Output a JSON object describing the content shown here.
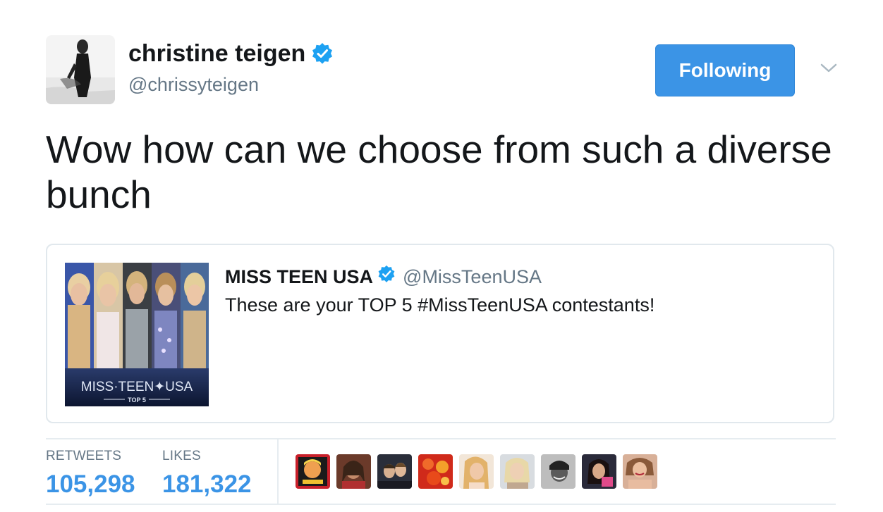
{
  "author": {
    "name": "christine teigen",
    "handle": "@chrissyteigen",
    "verified": true
  },
  "follow_button": {
    "label": "Following"
  },
  "tweet": {
    "text": "Wow how can we choose from such a diverse bunch"
  },
  "quoted_tweet": {
    "name": "MISS TEEN USA",
    "handle": "@MissTeenUSA",
    "verified": true,
    "text": "These are your TOP 5 #MissTeenUSA contestants!",
    "image_text": {
      "logo": "MISS·TEEN✦USA",
      "sub": "TOP 5"
    }
  },
  "stats": {
    "retweets_label": "RETWEETS",
    "retweets_value": "105,298",
    "likes_label": "LIKES",
    "likes_value": "181,322"
  },
  "colors": {
    "accent": "#3b94e6",
    "secondary_text": "#657786",
    "border": "#e1e8ed"
  },
  "likers_count_shown": 9
}
